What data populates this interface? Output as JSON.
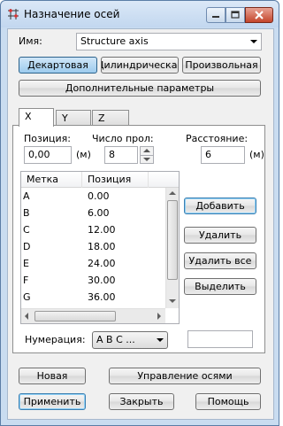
{
  "window": {
    "title": "Назначение осей"
  },
  "name_row": {
    "label": "Имя:",
    "value": "Structure axis"
  },
  "coord_buttons": [
    {
      "label": "Декартовая"
    },
    {
      "label": "Цилиндрическая"
    },
    {
      "label": "Произвольная"
    }
  ],
  "advanced_button": "Дополнительные параметры",
  "tabs": [
    {
      "label": "X"
    },
    {
      "label": "Y"
    },
    {
      "label": "Z"
    }
  ],
  "position": {
    "label": "Позиция:",
    "value": "0,00",
    "unit": "(м)"
  },
  "span_count": {
    "label": "Число прол:",
    "value": "8"
  },
  "distance": {
    "label": "Расстояние:",
    "value": "6",
    "unit": "(м)"
  },
  "table": {
    "headers": [
      "Метка",
      "Позиция"
    ],
    "rows": [
      {
        "mark": "A",
        "position": "0.00"
      },
      {
        "mark": "B",
        "position": "6.00"
      },
      {
        "mark": "C",
        "position": "12.00"
      },
      {
        "mark": "D",
        "position": "18.00"
      },
      {
        "mark": "E",
        "position": "24.00"
      },
      {
        "mark": "F",
        "position": "30.00"
      },
      {
        "mark": "G",
        "position": "36.00"
      }
    ]
  },
  "side_buttons": {
    "add": "Добавить",
    "delete": "Удалить",
    "delete_all": "Удалить все",
    "select": "Выделить"
  },
  "numbering": {
    "label": "Нумерация:",
    "value": "A B C ...",
    "extra_value": ""
  },
  "bottom_buttons": {
    "new": "Новая",
    "manage": "Управление осями",
    "apply": "Применить",
    "close": "Закрыть",
    "help": "Помощь"
  },
  "colors": {
    "accent": "#9ccbee",
    "close_button": "#c4452b",
    "titlebar": "#c2d7ef"
  }
}
